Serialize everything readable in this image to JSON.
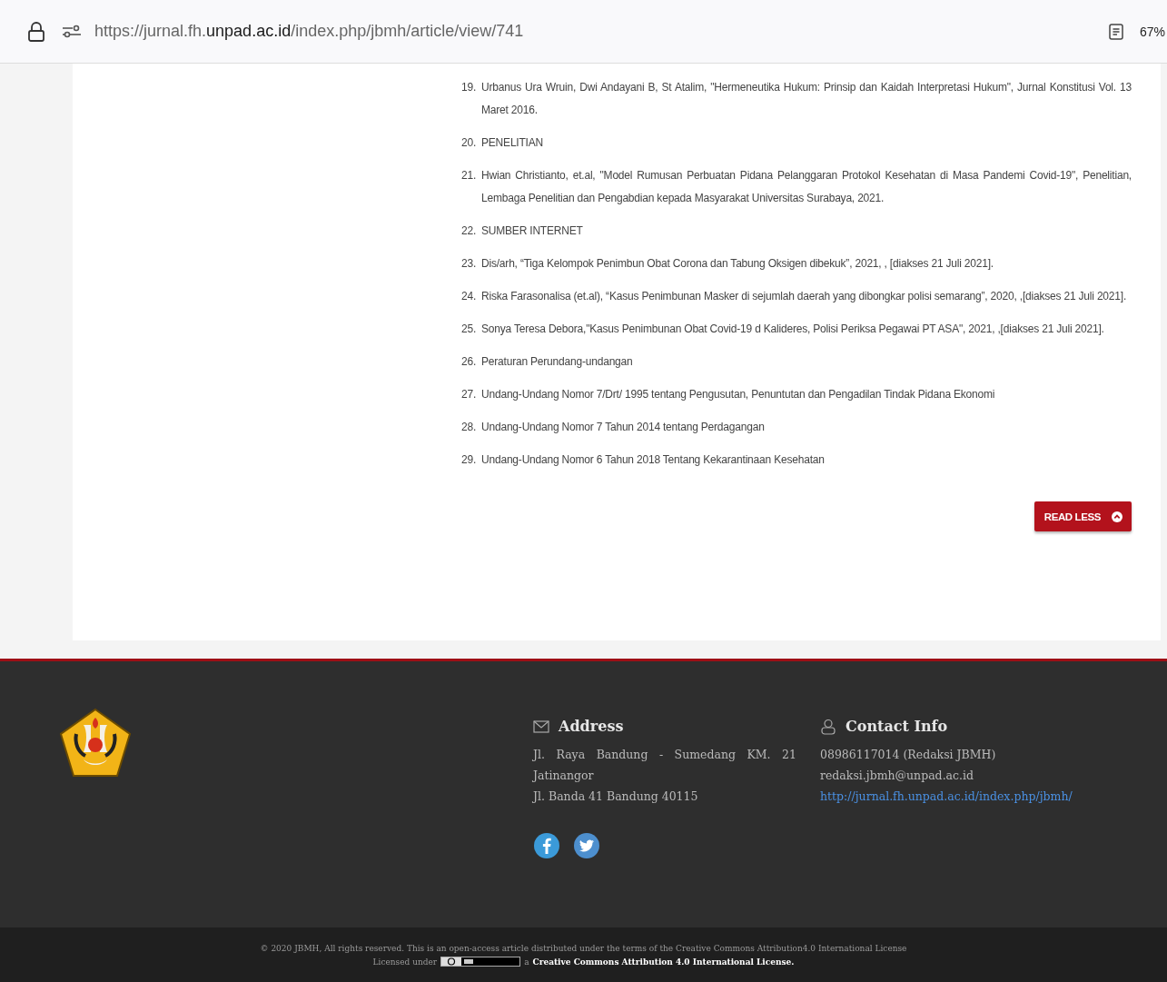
{
  "browser": {
    "url": "https://jurnal.fh.**unpad.ac.id**/index.php/jbmh/article/view/741",
    "zoom": "67%"
  },
  "references": [
    {
      "number": "19.",
      "text": "Urbanus Ura Wruin, Dwi Andayani B, St Atalim, \"Hermeneutika Hukum: Prinsip dan Kaidah Interpretasi Hukum\", Jurnal Konstitusi Vol. 13 Maret 2016."
    },
    {
      "number": "20.",
      "text": "PENELITIAN"
    },
    {
      "number": "21.",
      "text": "Hwian Christianto, et.al, \"Model Rumusan Perbuatan Pidana Pelanggaran Protokol Kesehatan di Masa Pandemi Covid-19\", Penelitian, Lembaga Penelitian dan Pengabdian kepada Masyarakat Universitas Surabaya, 2021."
    },
    {
      "number": "22.",
      "text": "SUMBER INTERNET"
    },
    {
      "number": "23.",
      "text": "Dis/arh, “Tiga Kelompok Penimbun Obat Corona dan Tabung Oksigen dibekuk”, 2021, , [diakses 21 Juli 2021]."
    },
    {
      "number": "24.",
      "text": "Riska Farasonalisa (et.al), “Kasus Penimbunan Masker di sejumlah daerah yang dibongkar polisi semarang”, 2020, ,[diakses 21 Juli 2021]."
    },
    {
      "number": "25.",
      "text": "Sonya Teresa Debora,\"Kasus Penimbunan Obat Covid-19 d Kalideres, Polisi Periksa Pegawai PT ASA\", 2021, ,[diakses 21 Juli 2021]."
    },
    {
      "number": "26.",
      "text": "Peraturan Perundang-undangan"
    },
    {
      "number": "27.",
      "text": "Undang-Undang Nomor 7/Drt/ 1995 tentang Pengusutan, Penuntutan dan Pengadilan Tindak Pidana Ekonomi"
    },
    {
      "number": "28.",
      "text": "Undang-Undang Nomor 7 Tahun 2014 tentang Perdagangan"
    },
    {
      "number": "29.",
      "text": "Undang-Undang Nomor 6 Tahun 2018 Tentang Kekarantinaan Kesehatan"
    }
  ],
  "read_less_button": {
    "label": "READ LESS"
  },
  "footer": {
    "address": {
      "heading": "Address",
      "lines": [
        "Jl. Raya Bandung - Sumedang KM. 21 Jatinangor",
        "Jl. Banda 41 Bandung 40115"
      ]
    },
    "contact": {
      "heading": "Contact Info",
      "phone": "08986117014 (Redaksi JBMH)",
      "email": "redaksi.jbmh@unpad.ac.id",
      "link": "http://jurnal.fh.unpad.ac.id/index.php/jbmh/"
    },
    "social": [
      {
        "kind": "facebook"
      },
      {
        "kind": "twitter"
      }
    ]
  },
  "bottom_bar": {
    "copyright": "© 2020 JBMH, All rights reserved. This is an open-access article distributed under the terms of the Creative Commons Attribution4.0 International License",
    "license_prefix": "Licensed under",
    "license_connector": "a",
    "license_link": "Creative Commons Attribution 4.0 International License."
  }
}
